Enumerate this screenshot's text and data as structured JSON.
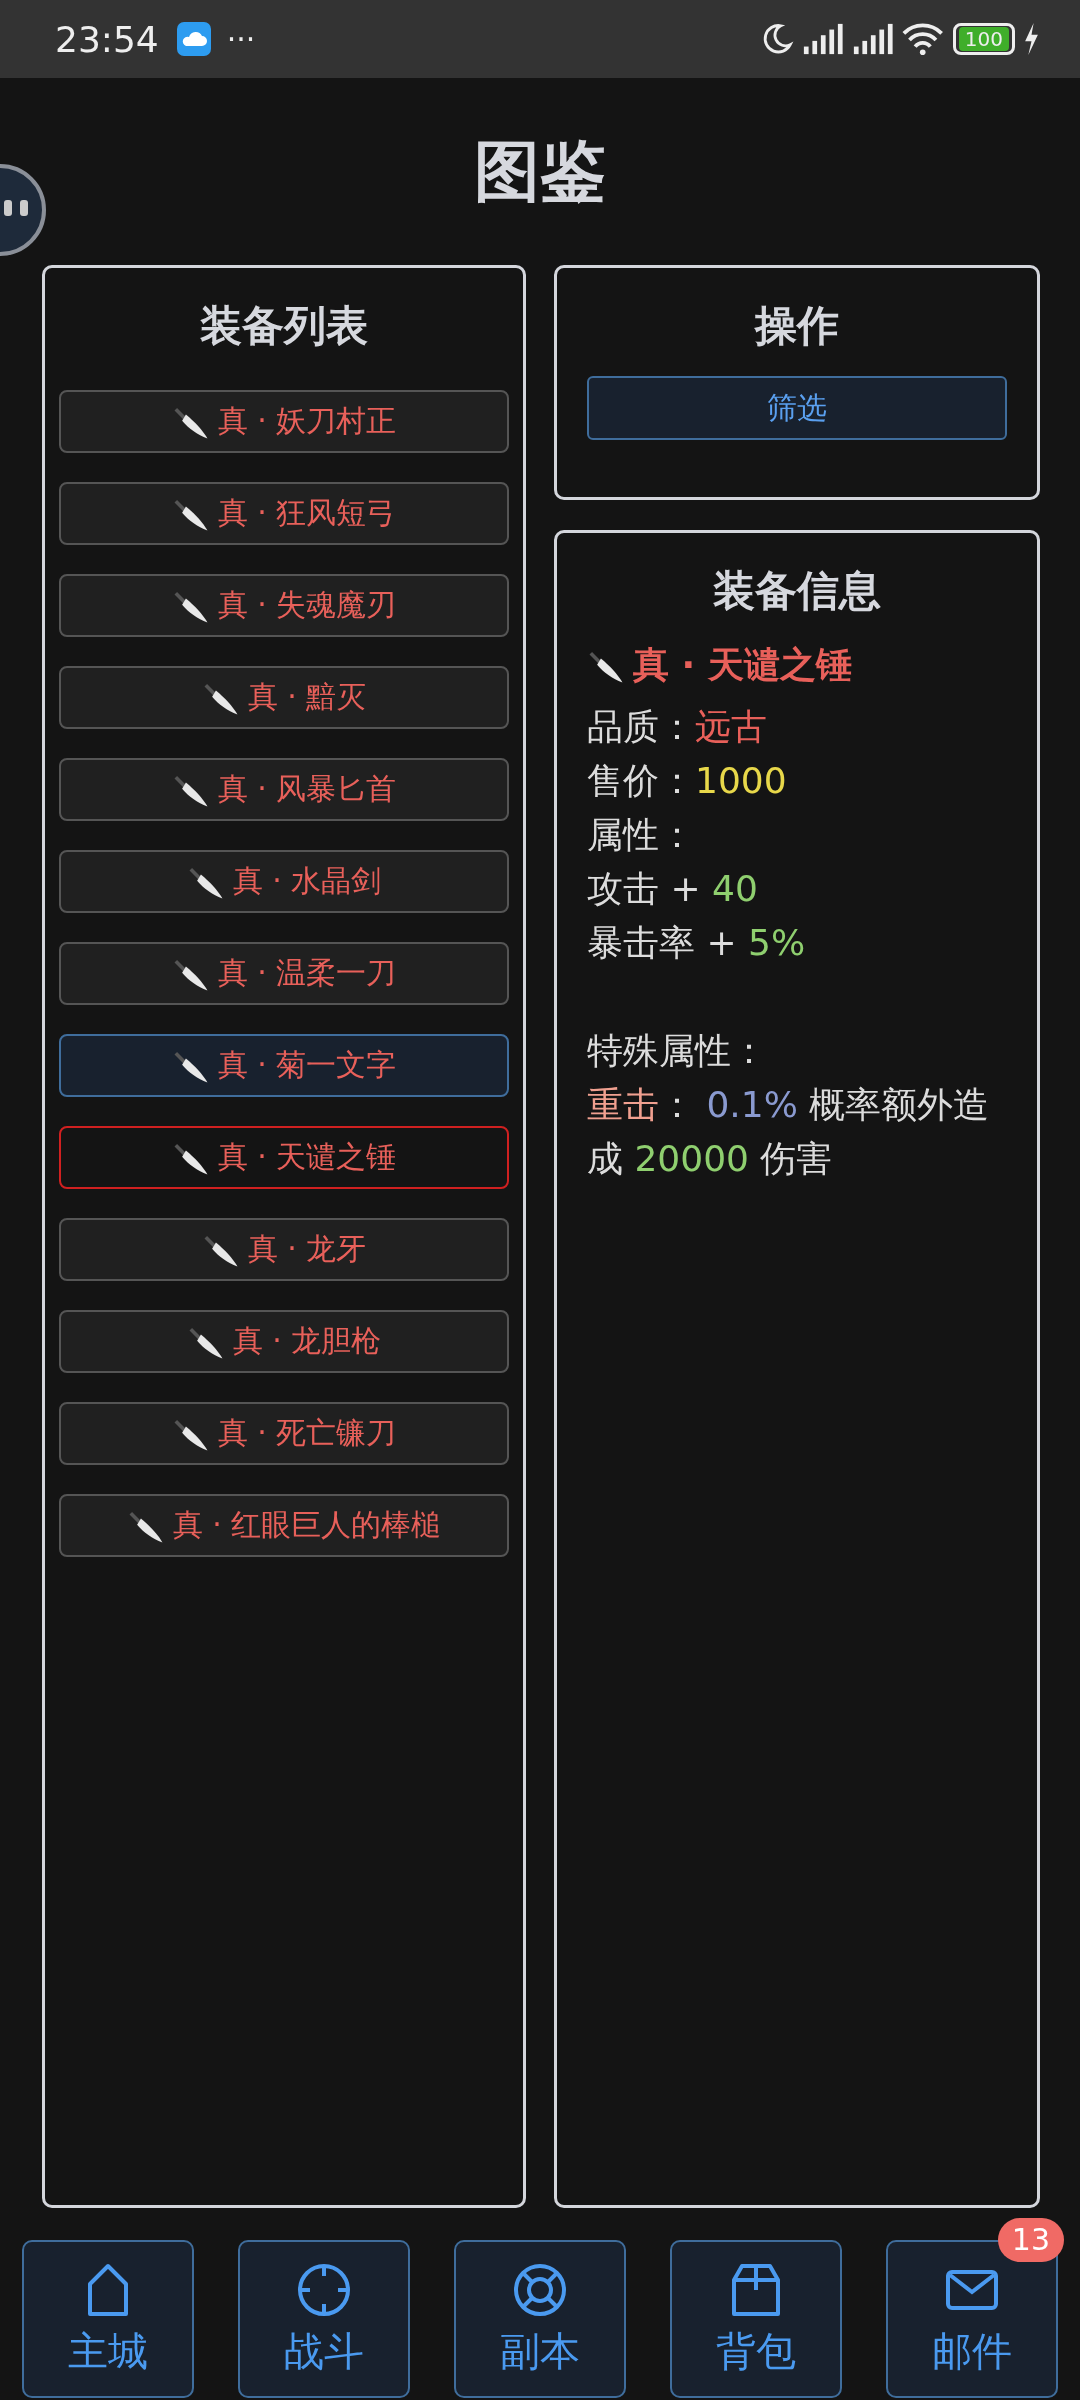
{
  "status_bar": {
    "time": "23:54",
    "more": "···",
    "battery": "100"
  },
  "title": "图鉴",
  "equipment_list": {
    "title": "装备列表",
    "items": [
      {
        "name": "真 · 妖刀村正",
        "selected": false,
        "hovered": false
      },
      {
        "name": "真 · 狂风短弓",
        "selected": false,
        "hovered": false
      },
      {
        "name": "真 · 失魂魔刃",
        "selected": false,
        "hovered": false
      },
      {
        "name": "真 · 黯灭",
        "selected": false,
        "hovered": false
      },
      {
        "name": "真 · 风暴匕首",
        "selected": false,
        "hovered": false
      },
      {
        "name": "真 · 水晶剑",
        "selected": false,
        "hovered": false
      },
      {
        "name": "真 · 温柔一刀",
        "selected": false,
        "hovered": false
      },
      {
        "name": "真 · 菊一文字",
        "selected": false,
        "hovered": true
      },
      {
        "name": "真 · 天谴之锤",
        "selected": true,
        "hovered": false
      },
      {
        "name": "真 · 龙牙",
        "selected": false,
        "hovered": false
      },
      {
        "name": "真 · 龙胆枪",
        "selected": false,
        "hovered": false
      },
      {
        "name": "真 · 死亡镰刀",
        "selected": false,
        "hovered": false
      },
      {
        "name": "真 · 红眼巨人的棒槌",
        "selected": false,
        "hovered": false
      }
    ]
  },
  "operations": {
    "title": "操作",
    "buttons": [
      "筛选"
    ]
  },
  "equipment_info": {
    "title": "装备信息",
    "name": "真 · 天谴之锤",
    "fields": [
      {
        "label": "品质：",
        "value": "远古",
        "color": "#e8605a"
      },
      {
        "label": "售价：",
        "value": "1000",
        "color": "#e8d84a"
      }
    ],
    "attributes_label": "属性：",
    "attributes": [
      {
        "label": "攻击 + ",
        "value": "40",
        "color": "#8fcf6f"
      },
      {
        "label": "暴击率 + ",
        "value": "5%",
        "color": "#8fcf6f"
      }
    ],
    "special_label": "特殊属性：",
    "special": [
      {
        "text": "重击",
        "color": "#f0a090"
      },
      {
        "text": "： ",
        "color": "#dcdcdc"
      },
      {
        "text": "0.1%",
        "color": "#8a9ad0"
      },
      {
        "text": " 概率额外造成 ",
        "color": "#dcdcdc"
      },
      {
        "text": "20000",
        "color": "#8fcf6f"
      },
      {
        "text": " 伤害",
        "color": "#dcdcdc"
      }
    ]
  },
  "nav": [
    {
      "kind": "home",
      "label": "主城"
    },
    {
      "kind": "battle",
      "label": "战斗"
    },
    {
      "kind": "dungeon",
      "label": "副本"
    },
    {
      "kind": "bag",
      "label": "背包"
    },
    {
      "kind": "mail",
      "label": "邮件",
      "badge": "13"
    }
  ]
}
